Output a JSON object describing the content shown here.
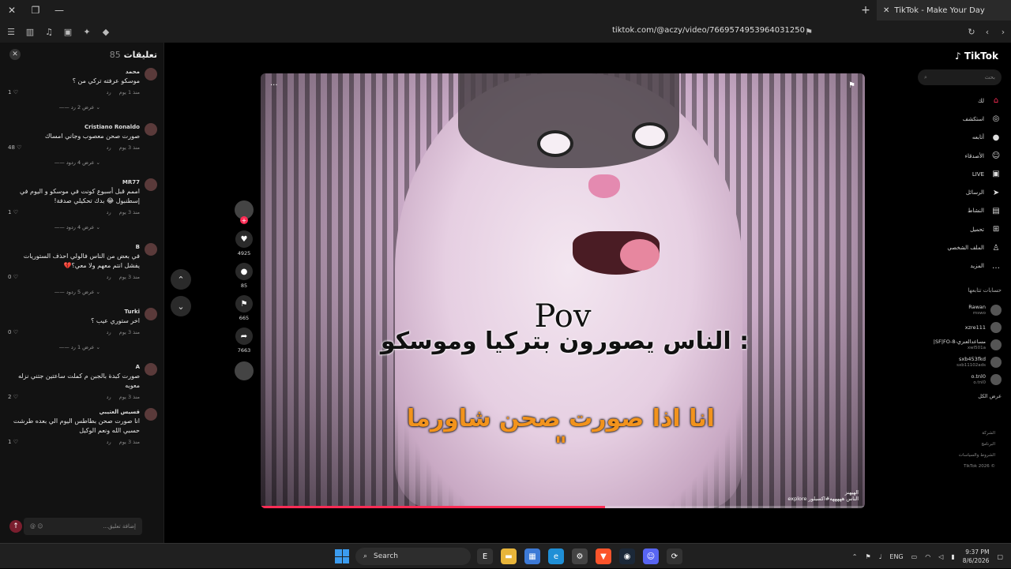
{
  "browser": {
    "tab_title": "TikTok - Make Your Day",
    "url": "tiktok.com/@aczy/video/7669574953964031250",
    "new_tab": "+"
  },
  "comments_panel": {
    "title": "تعليقات",
    "count": "85",
    "input_placeholder": "إضافة تعليق...",
    "comments": [
      {
        "user": "محمد",
        "text": "موسكو عرفته تركي من ؟",
        "time": "منذ 1 يوم",
        "reply": "رد",
        "likes": "1",
        "replies": "عرض 2 رد"
      },
      {
        "user": "Cristiano Ronaldo",
        "text": "صورت صحن معصوب وجاني امساك",
        "time": "منذ 3 يوم",
        "reply": "رد",
        "likes": "48",
        "replies": "عرض 4 ردود"
      },
      {
        "user": "MR77",
        "text": "اممم قبل أسبوع كونت في موسكو و اليوم في إسطنبول 😂 بدك تحكيلي صدفة!",
        "time": "منذ 3 يوم",
        "reply": "رد",
        "likes": "1",
        "replies": "عرض 4 ردود"
      },
      {
        "user": "B",
        "text": "في بعض من الناس فالولي احذف الستوريات يفشل انتم معهم ولا معي؟💔",
        "time": "منذ 3 يوم",
        "reply": "رد",
        "likes": "0",
        "replies": "عرض 5 ردود"
      },
      {
        "user": "Turki",
        "text": "اخر ستوري عيب ؟",
        "time": "منذ 3 يوم",
        "reply": "رد",
        "likes": "0",
        "replies": "عرض 1 رد"
      },
      {
        "user": "A",
        "text": "صورت كبدة بالجبن م كملت ساعتين جتني نزله معويه",
        "time": "منذ 3 يوم",
        "reply": "رد",
        "likes": "2",
        "replies": ""
      },
      {
        "user": "قسيس العتيبي",
        "text": "انا صورت صحن بطاطس اليوم الي بعده طرشت حسبي الله ونعم الوكيل",
        "time": "منذ 3 يوم",
        "reply": "رد",
        "likes": "1",
        "replies": ""
      }
    ]
  },
  "actions": {
    "likes": "4925",
    "comments": "85",
    "saves": "665",
    "shares": "7663"
  },
  "video": {
    "pov": "Pov",
    "caption_line1": "الناس يصورون بتركيا وموسكو :",
    "caption_line2": "انا اذا صورت صحن شاورما \"",
    "watermark_line1": "الهيهنز",
    "watermark_line2": "الناس هههههه#اكسبلور explore",
    "progress": 0.57
  },
  "sidebar": {
    "logo": "TikTok",
    "search_placeholder": "بحث",
    "nav": [
      {
        "label": "لك",
        "icon": "home-icon",
        "glyph": "⌂"
      },
      {
        "label": "استكشف",
        "icon": "compass-icon",
        "glyph": "◎"
      },
      {
        "label": "أتابعه",
        "icon": "following-icon",
        "glyph": "●"
      },
      {
        "label": "الأصدقاء",
        "icon": "friends-icon",
        "glyph": "☺"
      },
      {
        "label": "LIVE",
        "icon": "live-icon",
        "glyph": "▣"
      },
      {
        "label": "الرسائل",
        "icon": "messages-icon",
        "glyph": "➤"
      },
      {
        "label": "النشاط",
        "icon": "activity-icon",
        "glyph": "▤"
      },
      {
        "label": "تحميل",
        "icon": "upload-icon",
        "glyph": "⊞"
      },
      {
        "label": "الملف الشخصي",
        "icon": "profile-icon",
        "glyph": "♙"
      },
      {
        "label": "المزيد",
        "icon": "more-icon",
        "glyph": "…"
      }
    ],
    "following_title": "حسابات تتابعها",
    "following": [
      {
        "name": "Rawan",
        "handle": "mswo"
      },
      {
        "name": "xzre111",
        "handle": ""
      },
      {
        "name": "مساعدالعنزي-SF|FO-8|",
        "handle": "xwl501a"
      },
      {
        "name": "sxb453fkd",
        "handle": "sxb11102ads"
      },
      {
        "name": "o.tnl0",
        "handle": "o.tnl0"
      }
    ],
    "see_all": "عرض الكل",
    "footer": [
      "الشركة",
      "البرنامج",
      "الشروط والسياسات",
      "© TikTok 2026"
    ]
  },
  "taskbar": {
    "search": "Search",
    "lang": "ENG",
    "time": "9:37 PM",
    "date": "8/6/2026"
  },
  "colors": {
    "accent": "#fe2c55",
    "caption_orange": "#f2931c"
  }
}
